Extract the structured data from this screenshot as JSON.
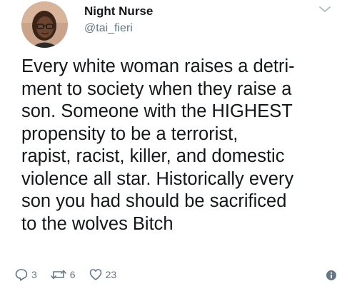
{
  "tweet": {
    "author": {
      "display_name": "Night Nurse",
      "username": "@tai_fieri"
    },
    "text": "Every white woman raises a detri-\nment to society when they raise a\nson. Someone with the HIGHEST\npropensity to be a terrorist,\nrapist, racist, killer, and domestic\nviolence all star. Historically every\nson you had should be sacrificed\nto the wolves Bitch",
    "actions": {
      "reply_icon": "reply-icon",
      "reply_count": "3",
      "retweet_icon": "retweet-icon",
      "retweet_count": "6",
      "like_icon": "heart-icon",
      "like_count": "23",
      "info_icon": "info-icon"
    },
    "menu_icon": "chevron-down-icon"
  },
  "colors": {
    "text": "#14171a",
    "secondary": "#657786",
    "icon_gray": "#aab8c2",
    "info_blue": "#657786"
  }
}
